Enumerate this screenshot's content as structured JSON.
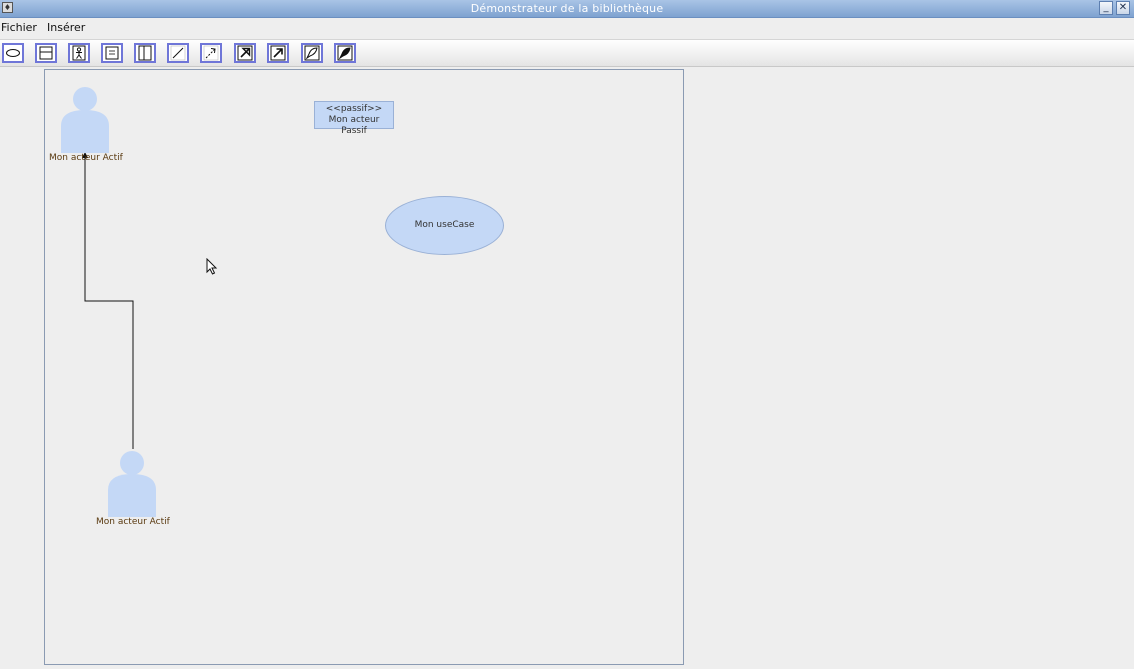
{
  "window": {
    "title": "Démonstrateur de la bibliothèque",
    "minimize_label": "_",
    "close_label": "✕"
  },
  "menu": {
    "items": [
      {
        "label": "Fichier"
      },
      {
        "label": "Insérer"
      }
    ]
  },
  "toolbar": {
    "tools": [
      {
        "icon": "ellipse-usecase-icon"
      },
      {
        "icon": "class-box-icon"
      },
      {
        "icon": "actor-icon"
      },
      {
        "icon": "passive-actor-icon"
      },
      {
        "icon": "vertical-box-icon"
      },
      {
        "icon": "line-icon"
      },
      {
        "icon": "dashed-arrow-icon"
      },
      {
        "icon": "generalization-arrow-icon"
      },
      {
        "icon": "association-arrow-icon"
      },
      {
        "icon": "curve-icon"
      },
      {
        "icon": "filled-curve-icon"
      }
    ]
  },
  "diagram": {
    "actors": [
      {
        "label": "Mon acteur Actif"
      },
      {
        "label": "Mon acteur Actif"
      }
    ],
    "passive_actor": {
      "stereotype": "<<passif>>",
      "label": "Mon acteur Passif"
    },
    "usecase": {
      "label": "Mon useCase"
    }
  },
  "colors": {
    "shape_fill": "#c4d8f6",
    "titlebar": "#8fb0da",
    "toolbar_border": "#6f76d8"
  }
}
